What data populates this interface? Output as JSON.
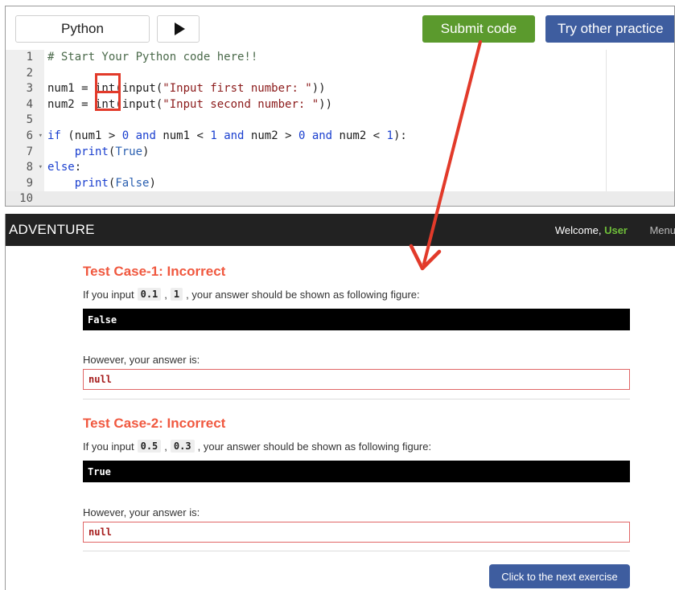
{
  "toolbar": {
    "language": "Python",
    "run_icon": "play-icon",
    "submit_label": "Submit code",
    "practice_label": "Try other practice"
  },
  "editor": {
    "lines": [
      {
        "num": "1",
        "segments": [
          {
            "t": "# Start Your Python code here!!",
            "c": "com"
          }
        ]
      },
      {
        "num": "2",
        "segments": []
      },
      {
        "num": "3",
        "segments": [
          {
            "t": "num1 = int(input(",
            "c": ""
          },
          {
            "t": "\"Input first number: \"",
            "c": "str"
          },
          {
            "t": "))",
            "c": ""
          }
        ]
      },
      {
        "num": "4",
        "segments": [
          {
            "t": "num2 = int(input(",
            "c": ""
          },
          {
            "t": "\"Input second number: \"",
            "c": "str"
          },
          {
            "t": "))",
            "c": ""
          }
        ]
      },
      {
        "num": "5",
        "segments": []
      },
      {
        "num": "6",
        "fold": true,
        "segments": [
          {
            "t": "if",
            "c": "kw"
          },
          {
            "t": " (num1 > ",
            "c": ""
          },
          {
            "t": "0",
            "c": "num"
          },
          {
            "t": " ",
            "c": ""
          },
          {
            "t": "and",
            "c": "kw"
          },
          {
            "t": " num1 < ",
            "c": ""
          },
          {
            "t": "1",
            "c": "num"
          },
          {
            "t": " ",
            "c": ""
          },
          {
            "t": "and",
            "c": "kw"
          },
          {
            "t": " num2 > ",
            "c": ""
          },
          {
            "t": "0",
            "c": "num"
          },
          {
            "t": " ",
            "c": ""
          },
          {
            "t": "and",
            "c": "kw"
          },
          {
            "t": " num2 < ",
            "c": ""
          },
          {
            "t": "1",
            "c": "num"
          },
          {
            "t": "):",
            "c": ""
          }
        ]
      },
      {
        "num": "7",
        "segments": [
          {
            "t": "    ",
            "c": ""
          },
          {
            "t": "print",
            "c": "kw"
          },
          {
            "t": "(",
            "c": ""
          },
          {
            "t": "True",
            "c": "bool"
          },
          {
            "t": ")",
            "c": ""
          }
        ]
      },
      {
        "num": "8",
        "fold": true,
        "segments": [
          {
            "t": "else",
            "c": "kw"
          },
          {
            "t": ":",
            "c": ""
          }
        ]
      },
      {
        "num": "9",
        "segments": [
          {
            "t": "    ",
            "c": ""
          },
          {
            "t": "print",
            "c": "kw"
          },
          {
            "t": "(",
            "c": ""
          },
          {
            "t": "False",
            "c": "bool"
          },
          {
            "t": ")",
            "c": ""
          }
        ]
      },
      {
        "num": "10",
        "active": true,
        "segments": []
      }
    ]
  },
  "navbar": {
    "brand": "ADVENTURE",
    "welcome_prefix": "Welcome,",
    "user": "User",
    "menu": "Menu"
  },
  "test_cases": [
    {
      "title": "Test Case-1: Incorrect",
      "desc_prefix": "If you input",
      "input_a": "0.1",
      "comma": ",",
      "input_b": "1",
      "desc_suffix": ", your answer should be shown as following figure:",
      "expected": "False",
      "however": "However, your answer is:",
      "answer": "null"
    },
    {
      "title": "Test Case-2: Incorrect",
      "desc_prefix": "If you input",
      "input_a": "0.5",
      "comma": ",",
      "input_b": "0.3",
      "desc_suffix": ", your answer should be shown as following figure:",
      "expected": "True",
      "however": "However, your answer is:",
      "answer": "null"
    }
  ],
  "next_label": "Click to the next exercise",
  "colors": {
    "submit": "#5b9a2d",
    "practice": "#3e5d9f",
    "incorrect": "#f0583f",
    "annotation": "#e23a2a",
    "navbar": "#222222"
  }
}
